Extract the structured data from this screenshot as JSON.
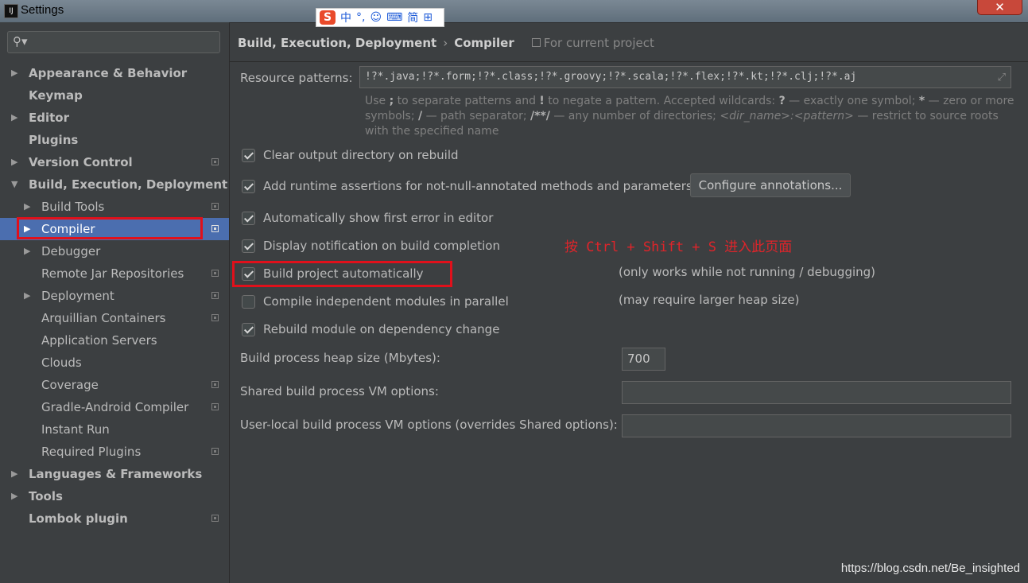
{
  "window": {
    "title": "Settings",
    "close_symbol": "✕"
  },
  "ime": {
    "logo": "S",
    "items": [
      "中",
      "°,",
      "☺",
      "⌨",
      "简",
      "⊞"
    ]
  },
  "sidebar": {
    "search_placeholder": "",
    "items": [
      {
        "label": "Appearance & Behavior",
        "bold": true,
        "level": 0,
        "arrow": "▶",
        "project": false
      },
      {
        "label": "Keymap",
        "bold": true,
        "level": 0,
        "arrow": "",
        "project": false
      },
      {
        "label": "Editor",
        "bold": true,
        "level": 0,
        "arrow": "▶",
        "project": false
      },
      {
        "label": "Plugins",
        "bold": true,
        "level": 0,
        "arrow": "",
        "project": false
      },
      {
        "label": "Version Control",
        "bold": true,
        "level": 0,
        "arrow": "▶",
        "project": true
      },
      {
        "label": "Build, Execution, Deployment",
        "bold": true,
        "level": 0,
        "arrow": "▼",
        "project": false
      },
      {
        "label": "Build Tools",
        "bold": false,
        "level": 1,
        "arrow": "▶",
        "project": true
      },
      {
        "label": "Compiler",
        "bold": false,
        "level": 1,
        "arrow": "▶",
        "project": true,
        "selected": true
      },
      {
        "label": "Debugger",
        "bold": false,
        "level": 1,
        "arrow": "▶",
        "project": false
      },
      {
        "label": "Remote Jar Repositories",
        "bold": false,
        "level": 1,
        "arrow": "",
        "project": true
      },
      {
        "label": "Deployment",
        "bold": false,
        "level": 1,
        "arrow": "▶",
        "project": true
      },
      {
        "label": "Arquillian Containers",
        "bold": false,
        "level": 1,
        "arrow": "",
        "project": true
      },
      {
        "label": "Application Servers",
        "bold": false,
        "level": 1,
        "arrow": "",
        "project": false
      },
      {
        "label": "Clouds",
        "bold": false,
        "level": 1,
        "arrow": "",
        "project": false
      },
      {
        "label": "Coverage",
        "bold": false,
        "level": 1,
        "arrow": "",
        "project": true
      },
      {
        "label": "Gradle-Android Compiler",
        "bold": false,
        "level": 1,
        "arrow": "",
        "project": true
      },
      {
        "label": "Instant Run",
        "bold": false,
        "level": 1,
        "arrow": "",
        "project": false
      },
      {
        "label": "Required Plugins",
        "bold": false,
        "level": 1,
        "arrow": "",
        "project": true
      },
      {
        "label": "Languages & Frameworks",
        "bold": true,
        "level": 0,
        "arrow": "▶",
        "project": false
      },
      {
        "label": "Tools",
        "bold": true,
        "level": 0,
        "arrow": "▶",
        "project": false
      },
      {
        "label": "Lombok plugin",
        "bold": true,
        "level": 0,
        "arrow": "",
        "project": true
      }
    ]
  },
  "breadcrumb": {
    "section": "Build, Execution, Deployment",
    "separator": "›",
    "page": "Compiler",
    "scope": "For current project"
  },
  "resource_patterns": {
    "label": "Resource patterns:",
    "value": "!?*.java;!?*.form;!?*.class;!?*.groovy;!?*.scala;!?*.flex;!?*.kt;!?*.clj;!?*.aj",
    "help_parts": [
      {
        "t": "Use ",
        "b": false
      },
      {
        "t": ";",
        "b": true
      },
      {
        "t": " to separate patterns and ",
        "b": false
      },
      {
        "t": "!",
        "b": true
      },
      {
        "t": " to negate a pattern. Accepted wildcards: ",
        "b": false
      },
      {
        "t": "?",
        "b": true
      },
      {
        "t": " — exactly one symbol; ",
        "b": false
      },
      {
        "t": "*",
        "b": true
      },
      {
        "t": " — zero or more symbols; ",
        "b": false
      },
      {
        "t": "/",
        "b": true
      },
      {
        "t": " — path separator; ",
        "b": false
      },
      {
        "t": "/**/",
        "b": true
      },
      {
        "t": " — any number of directories; ",
        "b": false
      },
      {
        "t": "<dir_name>:<pattern>",
        "b": false,
        "i": true
      },
      {
        "t": " — restrict to source roots with the specified name",
        "b": false
      }
    ]
  },
  "options": [
    {
      "label": "Clear output directory on rebuild",
      "checked": true
    },
    {
      "label": "Add runtime assertions for not-null-annotated methods and parameters",
      "checked": true
    },
    {
      "label": "Automatically show first error in editor",
      "checked": true
    },
    {
      "label": "Display notification on build completion",
      "checked": true
    },
    {
      "label": "Build project automatically",
      "checked": true
    },
    {
      "label": "Compile independent modules in parallel",
      "checked": false
    },
    {
      "label": "Rebuild module on dependency change",
      "checked": true
    }
  ],
  "configure_button": "Configure annotations...",
  "notes": {
    "build_auto": "(only works while not running / debugging)",
    "parallel": "(may require larger heap size)"
  },
  "annotation": "按 Ctrl + Shift + S 进入此页面",
  "fields": {
    "heap_label": "Build process heap size (Mbytes):",
    "heap_value": "700",
    "shared_label": "Shared build process VM options:",
    "shared_value": "",
    "user_label": "User-local build process VM options (overrides Shared options):",
    "user_value": ""
  },
  "watermark": "https://blog.csdn.net/Be_insighted",
  "colors": {
    "background": "#3c3f41",
    "selection": "#4b6eaf",
    "highlight": "#e0101b"
  }
}
